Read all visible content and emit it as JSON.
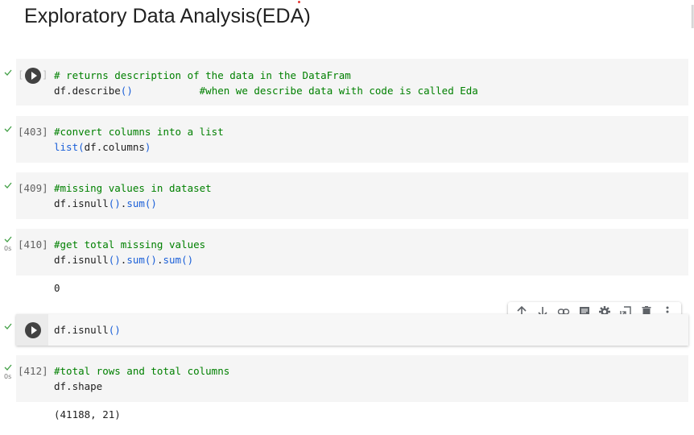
{
  "heading": "Exploratory Data Analysis(EDA)",
  "cells": [
    {
      "status": "success",
      "exec_label": "[ ]",
      "run_button": true,
      "lines": [
        {
          "comment": "# returns description of the data in the DataFram"
        },
        {
          "code": "df.describe",
          "parens": "()",
          "inline_comment": "#when we describe data with code is called Eda"
        }
      ]
    },
    {
      "status": "success",
      "exec_label": "[403]",
      "lines": [
        {
          "comment": "#convert columns into a list"
        },
        {
          "fn": "list",
          "open": "(",
          "code": "df.columns",
          "close": ")"
        }
      ]
    },
    {
      "status": "success",
      "exec_label": "[409]",
      "lines": [
        {
          "comment": "#missing values in dataset"
        },
        {
          "code": "df.isnull",
          "p1": "()",
          "dot": ".",
          "m2": "sum",
          "p2": "()"
        }
      ]
    },
    {
      "status": "success",
      "exec_label": "[410]",
      "time": "0s",
      "lines": [
        {
          "comment": "#get total missing values"
        },
        {
          "code": "df.isnull",
          "p1": "()",
          "dot1": ".",
          "m2": "sum",
          "p2": "()",
          "dot2": ".",
          "m3": "sum",
          "p3": "()"
        }
      ],
      "output": "0"
    },
    {
      "status": "success",
      "run_button": true,
      "focused": true,
      "lines": [
        {
          "code": "df.isnull",
          "parens": "()"
        }
      ]
    },
    {
      "status": "success",
      "exec_label": "[412]",
      "time": "0s",
      "lines": [
        {
          "comment": "#total rows and total columns"
        },
        {
          "code": "df.shape"
        }
      ],
      "output": "(41188, 21)"
    }
  ],
  "cell_toolbar": {
    "buttons": [
      {
        "name": "move-cell-up",
        "icon": "arrow-up-icon"
      },
      {
        "name": "move-cell-down",
        "icon": "arrow-down-icon"
      },
      {
        "name": "link-to-cell",
        "icon": "link-icon"
      },
      {
        "name": "add-comment",
        "icon": "comment-icon"
      },
      {
        "name": "open-editor-settings",
        "icon": "gear-icon"
      },
      {
        "name": "mirror-cell-in-tab",
        "icon": "mirror-icon"
      },
      {
        "name": "delete-cell",
        "icon": "trash-icon"
      },
      {
        "name": "more-cell-actions",
        "icon": "more-vert-icon"
      }
    ]
  },
  "colors": {
    "comment": "#008000",
    "paren": "#1a5fd8",
    "check": "#43a047",
    "cell_bg": "#f5f5f5"
  }
}
